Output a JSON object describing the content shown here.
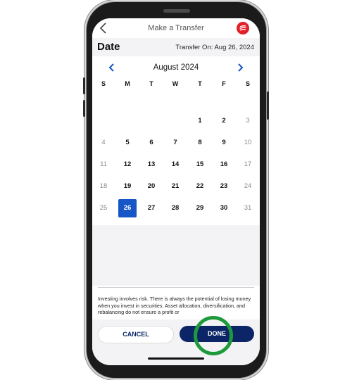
{
  "header": {
    "title": "Make a Transfer"
  },
  "section": {
    "label": "Date",
    "transfer_on": "Transfer On: Aug 26, 2024"
  },
  "calendar": {
    "month": "August 2024",
    "weekdays": [
      "S",
      "M",
      "T",
      "W",
      "T",
      "F",
      "S"
    ],
    "weeks": [
      [
        "",
        "",
        "",
        "",
        "1",
        "2",
        "3"
      ],
      [
        "4",
        "5",
        "6",
        "7",
        "8",
        "9",
        "10"
      ],
      [
        "11",
        "12",
        "13",
        "14",
        "15",
        "16",
        "17"
      ],
      [
        "18",
        "19",
        "20",
        "21",
        "22",
        "23",
        "24"
      ],
      [
        "25",
        "26",
        "27",
        "28",
        "29",
        "30",
        "31"
      ]
    ],
    "selected": "26"
  },
  "disclaimer": {
    "text": "Investing involves risk. There is always the potential of losing money when you invest in securities. Asset allocation, diversification, and rebalancing do not ensure a profit or"
  },
  "actions": {
    "cancel_label": "CANCEL",
    "done_label": "DONE"
  },
  "colors": {
    "accent": "#1756c6",
    "done_bg": "#0b2566",
    "highlight_ring": "#1f9a3a",
    "logo": "#e0202a"
  }
}
